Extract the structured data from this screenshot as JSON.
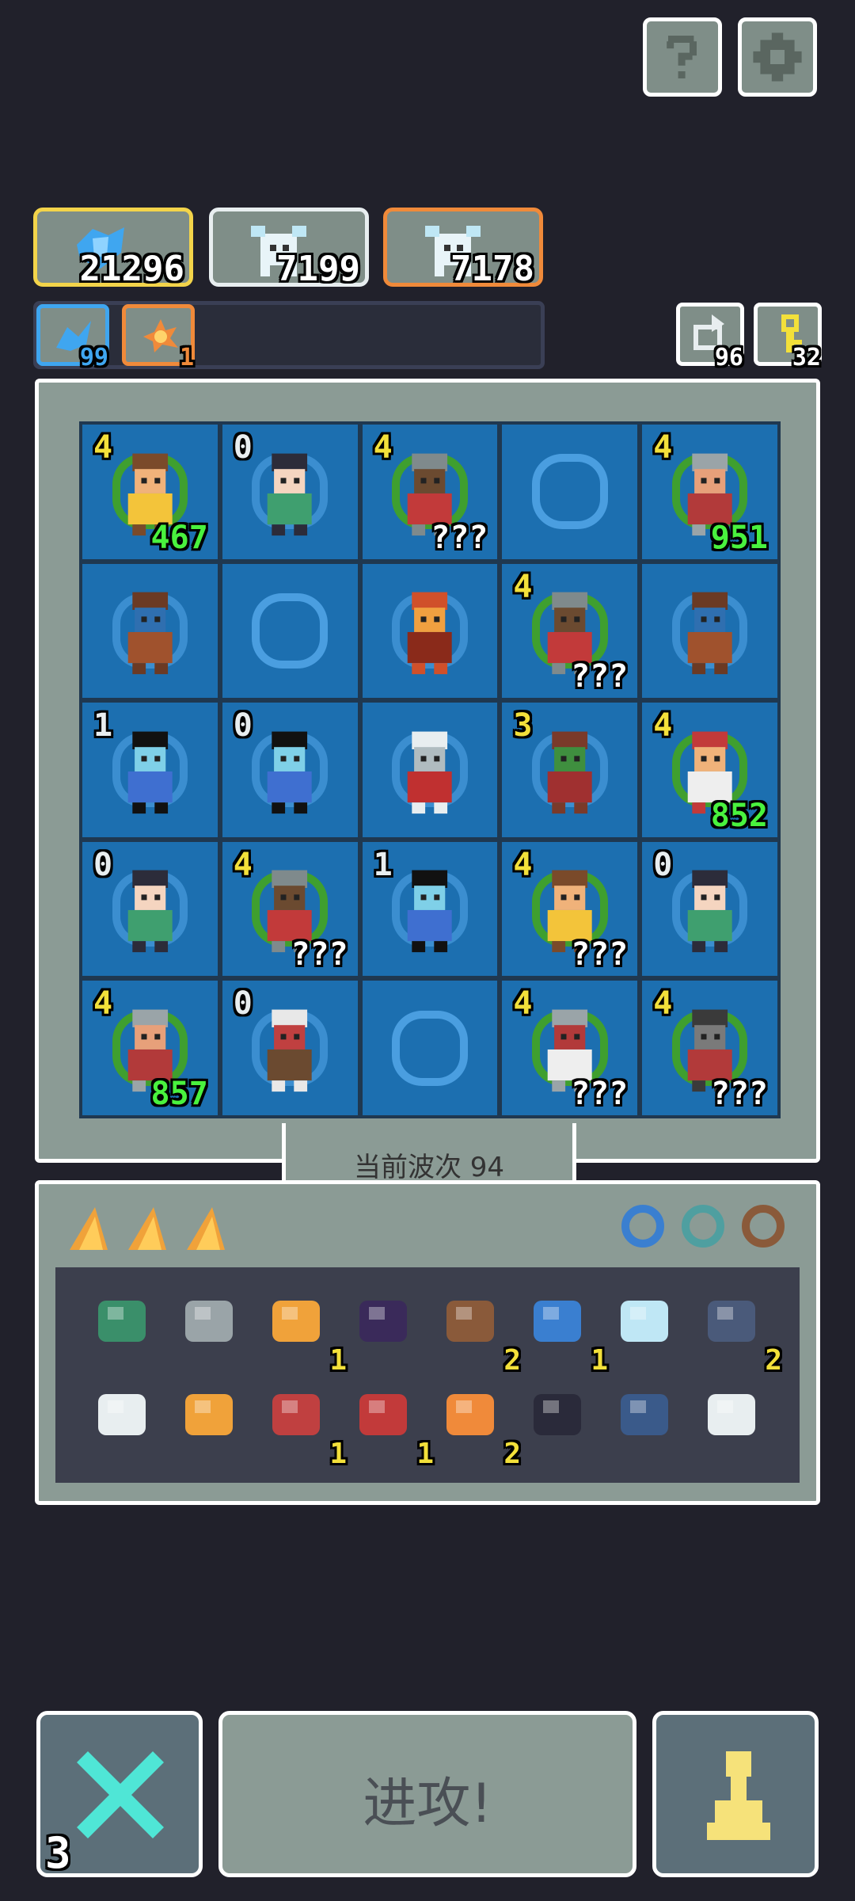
{
  "top_buttons": {
    "help_icon": "help-icon",
    "settings_icon": "gear-icon"
  },
  "resources": [
    {
      "icon": "blue-crystal-icon",
      "value": "21296",
      "border": "#f3d44a"
    },
    {
      "icon": "white-beast-icon",
      "value": "7199",
      "border": "#e8eef0"
    },
    {
      "icon": "white-beast-icon",
      "value": "7178",
      "border": "#f08a3a"
    }
  ],
  "buffs": [
    {
      "icon": "blue-buff-icon",
      "value": "99",
      "color": "#3fa6f0"
    },
    {
      "icon": "fire-buff-icon",
      "value": "1",
      "color": "#f08a3a"
    }
  ],
  "counters": [
    {
      "icon": "refresh-icon",
      "value": "96"
    },
    {
      "icon": "key-icon",
      "value": "32"
    }
  ],
  "board": [
    [
      {
        "unit": "warrior-headband",
        "level": "4",
        "hp": "467",
        "hp_color": "green",
        "selected": true
      },
      {
        "unit": "snake-girl",
        "level": "0"
      },
      {
        "unit": "shield-knight",
        "level": "4",
        "hp": "???",
        "hp_color": "white",
        "selected": true
      },
      {
        "unit": "empty"
      },
      {
        "unit": "spearman",
        "level": "4",
        "hp": "951",
        "hp_color": "green",
        "selected": true
      }
    ],
    [
      {
        "unit": "rock-monster"
      },
      {
        "unit": "empty"
      },
      {
        "unit": "red-dragon"
      },
      {
        "unit": "shield-knight",
        "level": "4",
        "hp": "???",
        "hp_color": "white",
        "selected": true
      },
      {
        "unit": "rock-monster"
      }
    ],
    [
      {
        "unit": "mermaid",
        "level": "1"
      },
      {
        "unit": "mermaid",
        "level": "0"
      },
      {
        "unit": "white-yeti"
      },
      {
        "unit": "cactus-plant",
        "level": "3"
      },
      {
        "unit": "red-hat-brute",
        "level": "4",
        "hp": "852",
        "hp_color": "green",
        "selected": true
      }
    ],
    [
      {
        "unit": "snake-girl",
        "level": "0"
      },
      {
        "unit": "shield-knight",
        "level": "4",
        "hp": "???",
        "hp_color": "white",
        "selected": true
      },
      {
        "unit": "mermaid",
        "level": "1"
      },
      {
        "unit": "warrior-headband",
        "level": "4",
        "hp": "???",
        "hp_color": "white",
        "selected": true
      },
      {
        "unit": "snake-girl",
        "level": "0"
      }
    ],
    [
      {
        "unit": "spearman",
        "level": "4",
        "hp": "857",
        "hp_color": "green",
        "selected": true
      },
      {
        "unit": "old-mage",
        "level": "0"
      },
      {
        "unit": "empty"
      },
      {
        "unit": "armored-knight",
        "level": "4",
        "hp": "???",
        "hp_color": "white",
        "selected": true
      },
      {
        "unit": "dark-knight",
        "level": "4",
        "hp": "???",
        "hp_color": "white",
        "selected": true
      }
    ]
  ],
  "wave": {
    "label": "当前波次 94"
  },
  "inventory": {
    "tabs": [
      "orange-shard-icon",
      "orange-shard-icon",
      "orange-shard-icon"
    ],
    "rings": [
      "blue-ring-icon",
      "teal-ring-icon",
      "brown-ring-icon"
    ],
    "row1": [
      {
        "icon": "green-shell-icon",
        "count": ""
      },
      {
        "icon": "hammer-icon",
        "count": ""
      },
      {
        "icon": "flame-icon",
        "count": "1"
      },
      {
        "icon": "bat-icon",
        "count": ""
      },
      {
        "icon": "blue-wand-icon",
        "count": "2"
      },
      {
        "icon": "blue-gem-icon",
        "count": "1"
      },
      {
        "icon": "ice-totem-icon",
        "count": ""
      },
      {
        "icon": "stairs-icon",
        "count": "2"
      }
    ],
    "row2": [
      {
        "icon": "boot-icon",
        "count": ""
      },
      {
        "icon": "fox-tail-icon",
        "count": ""
      },
      {
        "icon": "sword-icon",
        "count": "1"
      },
      {
        "icon": "red-claw-icon",
        "count": "1"
      },
      {
        "icon": "shrimp-icon",
        "count": "2"
      },
      {
        "icon": "telescope-icon",
        "count": ""
      },
      {
        "icon": "blue-rock-icon",
        "count": ""
      },
      {
        "icon": "ice-crystal-icon",
        "count": ""
      }
    ]
  },
  "bottom": {
    "swords_count": "3",
    "attack_label": "进攻!",
    "pawn_icon": "pawn-icon"
  }
}
